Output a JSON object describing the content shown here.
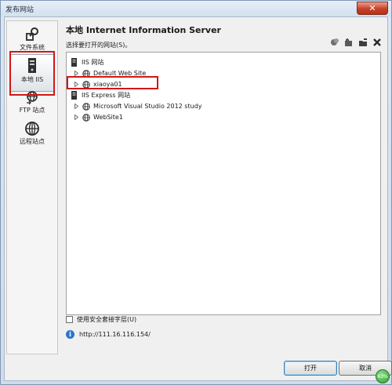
{
  "window": {
    "title": "发布网站",
    "close_glyph": "✕"
  },
  "sidebar": {
    "items": [
      {
        "label": "文件系统",
        "icon": "file-system-icon"
      },
      {
        "label": "本地 IIS",
        "icon": "local-iis-server-icon",
        "selected": true
      },
      {
        "label": "FTP 站点",
        "icon": "ftp-site-icon"
      },
      {
        "label": "远程站点",
        "icon": "remote-site-globe-icon"
      }
    ]
  },
  "main": {
    "title": "本地 Internet Information Server",
    "subtitle": "选择要打开的网站(S)。",
    "toolbar_icons": [
      "new-web-application-icon",
      "new-virtual-directory-icon",
      "create-folder-icon",
      "delete-icon"
    ]
  },
  "tree": {
    "nodes": [
      {
        "label": "IIS 网站",
        "level": 0,
        "icon": "iis-sites-icon"
      },
      {
        "label": "Default Web Site",
        "level": 1,
        "icon": "globe-icon"
      },
      {
        "label": "xiaoya01",
        "level": 1,
        "icon": "globe-icon"
      },
      {
        "label": "IIS Express 网站",
        "level": 0,
        "icon": "iis-express-sites-icon"
      },
      {
        "label": "Microsoft Visual Studio 2012 study",
        "level": 1,
        "icon": "globe-icon"
      },
      {
        "label": "WebSite1",
        "level": 1,
        "icon": "globe-icon"
      }
    ]
  },
  "options": {
    "ssl_label": "使用安全套接字层(U)",
    "ssl_checked": false
  },
  "url": {
    "value": "http://111.16.116.154/"
  },
  "buttons": {
    "open_label": "打开",
    "cancel_label": "取消"
  },
  "status": {
    "badge_text": "63%"
  },
  "colors": {
    "highlight_box": "#d11818",
    "accent": "#2b74c9"
  }
}
